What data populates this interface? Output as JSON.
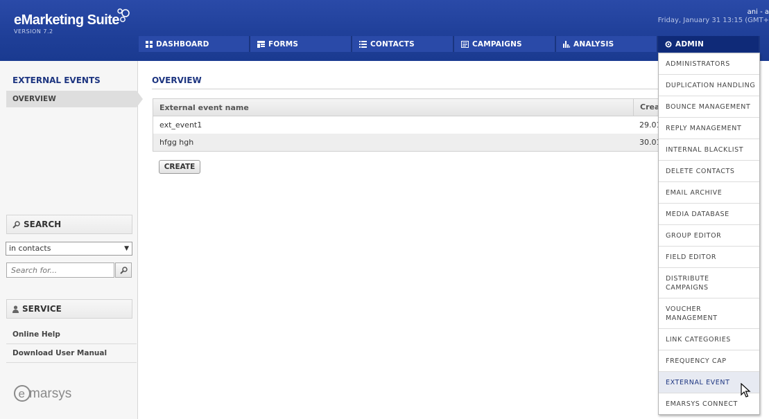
{
  "header": {
    "logo_text": "eMarketing Suite",
    "version": "VERSION 7.2",
    "user": "ani - a",
    "datetime": "Friday, January 31 13:15 (GMT+"
  },
  "nav": {
    "items": [
      {
        "label": "DASHBOARD",
        "icon": "dashboard-grid-icon"
      },
      {
        "label": "FORMS",
        "icon": "forms-icon"
      },
      {
        "label": "CONTACTS",
        "icon": "contacts-list-icon"
      },
      {
        "label": "CAMPAIGNS",
        "icon": "campaigns-icon"
      },
      {
        "label": "ANALYSIS",
        "icon": "bar-chart-icon"
      },
      {
        "label": "ADMIN",
        "icon": "gear-icon"
      }
    ]
  },
  "sidebar": {
    "title": "EXTERNAL EVENTS",
    "active_item": "OVERVIEW",
    "search": {
      "heading": "SEARCH",
      "scope_selected": "in contacts",
      "placeholder": "Search for..."
    },
    "service": {
      "heading": "SERVICE",
      "links": [
        "Online Help",
        "Download User Manual"
      ]
    },
    "brand": "emarsys"
  },
  "main": {
    "title": "OVERVIEW",
    "table": {
      "columns": [
        "External event name",
        "Crea"
      ],
      "rows": [
        {
          "name": "ext_event1",
          "created": "29.01"
        },
        {
          "name": "hfgg hgh",
          "created": "30.01"
        }
      ]
    },
    "create_label": "CREATE"
  },
  "admin_menu": {
    "items": [
      "ADMINISTRATORS",
      "DUPLICATION HANDLING",
      "BOUNCE MANAGEMENT",
      "REPLY MANAGEMENT",
      "INTERNAL BLACKLIST",
      "DELETE CONTACTS",
      "EMAIL ARCHIVE",
      "MEDIA DATABASE",
      "GROUP EDITOR",
      "FIELD EDITOR",
      "DISTRIBUTE CAMPAIGNS",
      "VOUCHER MANAGEMENT",
      "LINK CATEGORIES",
      "FREQUENCY CAP",
      "EXTERNAL EVENT",
      "EMARSYS CONNECT"
    ],
    "highlighted": "EXTERNAL EVENT"
  },
  "colors": {
    "header_blue": "#1f3f98",
    "active_nav": "#0f2a78",
    "title_blue": "#1d3580"
  }
}
